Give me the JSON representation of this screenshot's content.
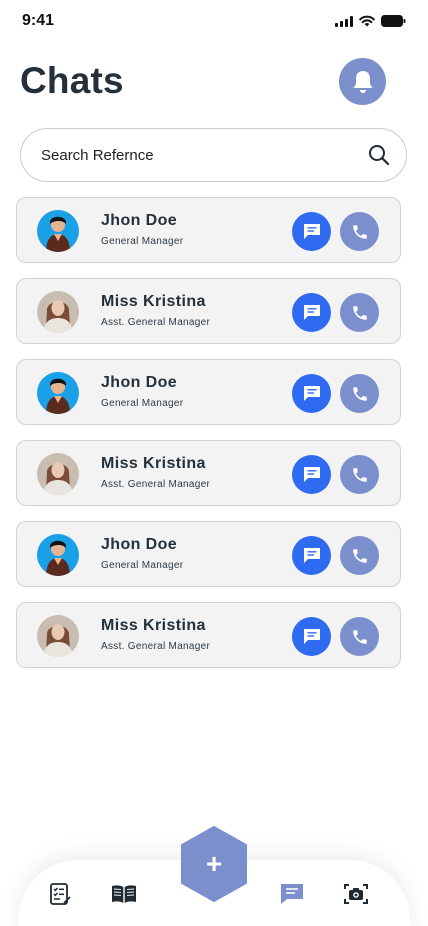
{
  "status_bar": {
    "time": "9:41"
  },
  "header": {
    "title": "Chats"
  },
  "search": {
    "placeholder": "Search Refernce"
  },
  "chats": [
    {
      "name": "Jhon Doe",
      "role": "General Manager",
      "avatar": "male"
    },
    {
      "name": "Miss Kristina",
      "role": "Asst. General Manager",
      "avatar": "female"
    },
    {
      "name": "Jhon Doe",
      "role": "General Manager",
      "avatar": "male"
    },
    {
      "name": "Miss Kristina",
      "role": "Asst. General Manager",
      "avatar": "female"
    },
    {
      "name": "Jhon Doe",
      "role": "General Manager",
      "avatar": "male"
    },
    {
      "name": "Miss Kristina",
      "role": "Asst. General Manager",
      "avatar": "female"
    }
  ],
  "nav": {
    "items": [
      "checklist-icon",
      "book-icon",
      "add-button",
      "chat-icon",
      "camera-icon"
    ],
    "fab_label": "+",
    "active": "chat-icon"
  },
  "colors": {
    "accent": "#7b8fcd",
    "message_button": "#2f6bf0",
    "card_bg": "#f3f3f4",
    "title": "#24313a"
  }
}
